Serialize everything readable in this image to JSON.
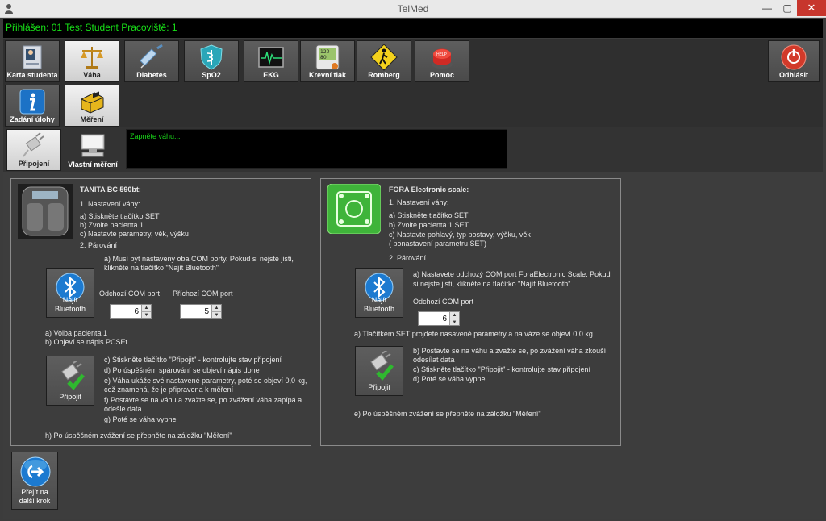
{
  "window": {
    "title": "TelMed",
    "minimize": "—",
    "maximize": "▢",
    "close": "✕"
  },
  "status": {
    "logged_in": "Přihlášen: 01 Test Student Pracoviště: 1"
  },
  "toolbar1": {
    "karta": "Karta studenta",
    "vaha": "Váha",
    "diabetes": "Diabetes",
    "spo2": "SpO2",
    "ekg": "EKG",
    "tlak": "Krevní tlak",
    "romberg": "Romberg",
    "pomoc": "Pomoc",
    "odhlasit": "Odhlásit"
  },
  "toolbar2": {
    "zadani": "Zadání úlohy",
    "mereni": "Měření"
  },
  "toolbar3": {
    "pripojeni": "Připojení",
    "vlastni": "Vlastní měření",
    "console": "Zapněte váhu..."
  },
  "tanita": {
    "title": "TANITA BC 590bt:",
    "l1": "1. Nastavení váhy:",
    "l2": "a) Stiskněte tlačítko SET",
    "l3": "b) Zvolte pacienta 1",
    "l4": "c) Nastavte parametry,  věk, výšku",
    "l5": "2. Párování",
    "l6": "a) Musí být nastaveny oba COM porty. Pokud si nejste jisti,",
    "l7": "klikněte na tlačítko \"Najít Bluetooth\"",
    "bt_line1": "Najít",
    "bt_line2": "Bluetooth",
    "out_label": "Odchozí COM port",
    "in_label": "Příchozí COM port",
    "out_value": "6",
    "in_value": "5",
    "l8": "a) Volba pacienta 1",
    "l9": "b) Objeví se nápis PCSEt",
    "c1": "c) Stiskněte tlačítko \"Připojit\" - kontrolujte stav připojení",
    "c2": "d) Po úspěšném spárování se objeví nápis done",
    "c3": "e) Váha ukáže své nastavené parametry, poté se objeví 0,0 kg,",
    "c4": "což znamená, že je připravena k měření",
    "c5": "f) Postavte se na váhu a zvažte se, po zvážení váha zapípá a",
    "c6": "odešle data",
    "c7": "g) Poté se váha vypne",
    "connect": "Připojit",
    "h": "h) Po úspěšném zvážení se přepněte na záložku \"Měření\""
  },
  "fora": {
    "title": "FORA Electronic scale:",
    "l1": "1. Nastavení váhy:",
    "l2": "a) Stiskněte tlačítko SET",
    "l3": "b) Zvolte pacienta 1 SET",
    "l4": "c) Nastavte pohlavý, typ postavy, výšku, věk",
    "l5": "( ponastavení parametru SET)",
    "l6": "2. Párování",
    "l7": "a) Nastavete odchozý COM port ForaElectronic Scale. Pokud",
    "l8": "si nejste jisti, klikněte na tlačítko \"Najít Bluetooth\"",
    "bt_line1": "Najít",
    "bt_line2": "Bluetooth",
    "out_label": "Odchozí COM port",
    "out_value": "6",
    "l9": "a) Tlačítkem SET projdete nasavené parametry a na váze se objeví 0,0 kg",
    "c1": "b) Postavte se na váhu a zvažte se, po zvážení váha zkouší",
    "c2": "odesílat data",
    "c3": "c) Stiskněte tlačítko \"Připojit\" - kontrolujte stav připojení",
    "c4": "d) Poté se váha vypne",
    "connect": "Připojit",
    "e": "e) Po úspěšném zvážení se přepněte na záložku \"Měření\""
  },
  "next": {
    "line1": "Přejít na",
    "line2": "další krok"
  }
}
